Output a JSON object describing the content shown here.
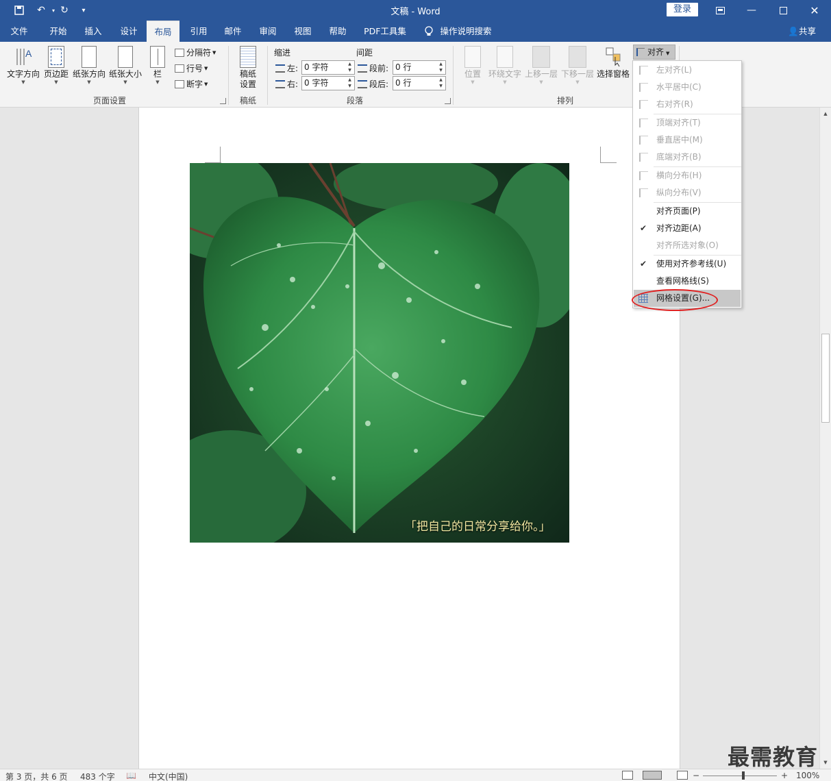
{
  "titlebar": {
    "title": "文稿 - Word",
    "login": "登录"
  },
  "tabs": [
    "文件",
    "开始",
    "插入",
    "设计",
    "布局",
    "引用",
    "邮件",
    "审阅",
    "视图",
    "帮助",
    "PDF工具集",
    "操作说明搜索"
  ],
  "share": "共享",
  "ribbon": {
    "page_setup": {
      "text_direction": "文字方向",
      "margins": "页边距",
      "orientation": "纸张方向",
      "size": "纸张大小",
      "columns": "栏",
      "breaks": "分隔符",
      "line_numbers": "行号",
      "hyphenation": "断字",
      "group": "页面设置"
    },
    "manuscript": {
      "button_l1": "稿纸",
      "button_l2": "设置",
      "group": "稿纸"
    },
    "paragraph": {
      "indent": "缩进",
      "spacing": "间距",
      "left": "左:",
      "right": "右:",
      "before": "段前:",
      "after": "段后:",
      "left_val": "0 字符",
      "right_val": "0 字符",
      "before_val": "0 行",
      "after_val": "0 行",
      "group": "段落"
    },
    "arrange": {
      "position": "位置",
      "wrap": "环绕文字",
      "forward": "上移一层",
      "backward": "下移一层",
      "selection_pane": "选择窗格",
      "align": "对齐",
      "group": "排列"
    }
  },
  "align_menu": {
    "items": [
      "左对齐(L)",
      "水平居中(C)",
      "右对齐(R)",
      "顶端对齐(T)",
      "垂直居中(M)",
      "底端对齐(B)",
      "横向分布(H)",
      "纵向分布(V)",
      "对齐页面(P)",
      "对齐边距(A)",
      "对齐所选对象(O)",
      "使用对齐参考线(U)",
      "查看网格线(S)",
      "网格设置(G)..."
    ]
  },
  "document": {
    "caption": "「把自己的日常分享给你。」"
  },
  "status": {
    "page": "第 3 页，共 6 页",
    "words": "483 个字",
    "lang": "中文(中国)",
    "zoom": "100%"
  },
  "watermark": "最需教育"
}
